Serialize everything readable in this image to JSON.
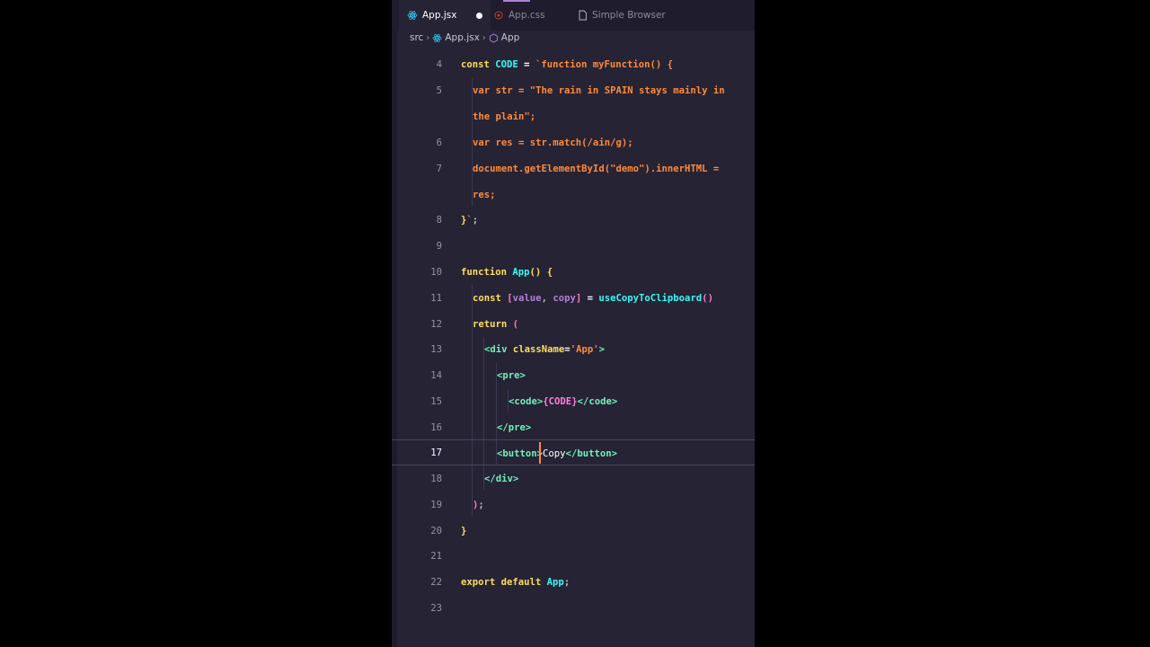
{
  "tabs": [
    {
      "label": "App.jsx",
      "icon": "react-icon",
      "active": true,
      "modified": true
    },
    {
      "label": "App.css",
      "icon": "css-icon",
      "active": false
    },
    {
      "label": "Simple Browser",
      "icon": "file-icon",
      "active": false
    }
  ],
  "breadcrumb": {
    "folder": "src",
    "file": "App.jsx",
    "symbol": "App"
  },
  "lines": [
    {
      "num": "4"
    },
    {
      "num": "5"
    },
    {
      "num": ""
    },
    {
      "num": "6"
    },
    {
      "num": "7"
    },
    {
      "num": ""
    },
    {
      "num": "8"
    },
    {
      "num": "9"
    },
    {
      "num": "10"
    },
    {
      "num": "11"
    },
    {
      "num": "12"
    },
    {
      "num": "13"
    },
    {
      "num": "14"
    },
    {
      "num": "15"
    },
    {
      "num": "16"
    },
    {
      "num": "17"
    },
    {
      "num": "18"
    },
    {
      "num": "19"
    },
    {
      "num": "20"
    },
    {
      "num": "21"
    },
    {
      "num": "22"
    },
    {
      "num": "23"
    }
  ],
  "code": {
    "l4": [
      "const ",
      "CODE",
      " = ",
      "`function myFunction() {"
    ],
    "l5a": [
      "var str = \"The rain in SPAIN stays mainly in"
    ],
    "l5b": [
      "the plain\";"
    ],
    "l6": [
      "var res = str.match(/ain/g);"
    ],
    "l7a": [
      "document.getElementById(\"demo\").innerHTML ="
    ],
    "l7b": [
      "res;"
    ],
    "l8": [
      "}",
      "`",
      ";"
    ],
    "l10": [
      "function ",
      "App",
      "()",
      " {"
    ],
    "l11": [
      "const ",
      "[",
      "value",
      ", ",
      "copy",
      "]",
      " = ",
      "useCopyToClipboard",
      "()"
    ],
    "l12": [
      "return ",
      "("
    ],
    "l13": [
      "<div ",
      "className",
      "=",
      "'App'",
      ">"
    ],
    "l14": [
      "<pre>"
    ],
    "l15": [
      "<code>",
      "{",
      "CODE",
      "}",
      "</code>"
    ],
    "l16": [
      "</pre>"
    ],
    "l17": [
      "<button",
      ">",
      "Copy",
      "</button>"
    ],
    "l18": [
      "</div>"
    ],
    "l19": [
      ")",
      ";"
    ],
    "l20": [
      "}"
    ],
    "l22": [
      "export default ",
      "App",
      ";"
    ]
  },
  "colors": {
    "editor_bg": "#262335",
    "keyword": "#fede5d",
    "string": "#ff8b39",
    "function": "#36f9f6",
    "tag": "#72f1b8"
  }
}
